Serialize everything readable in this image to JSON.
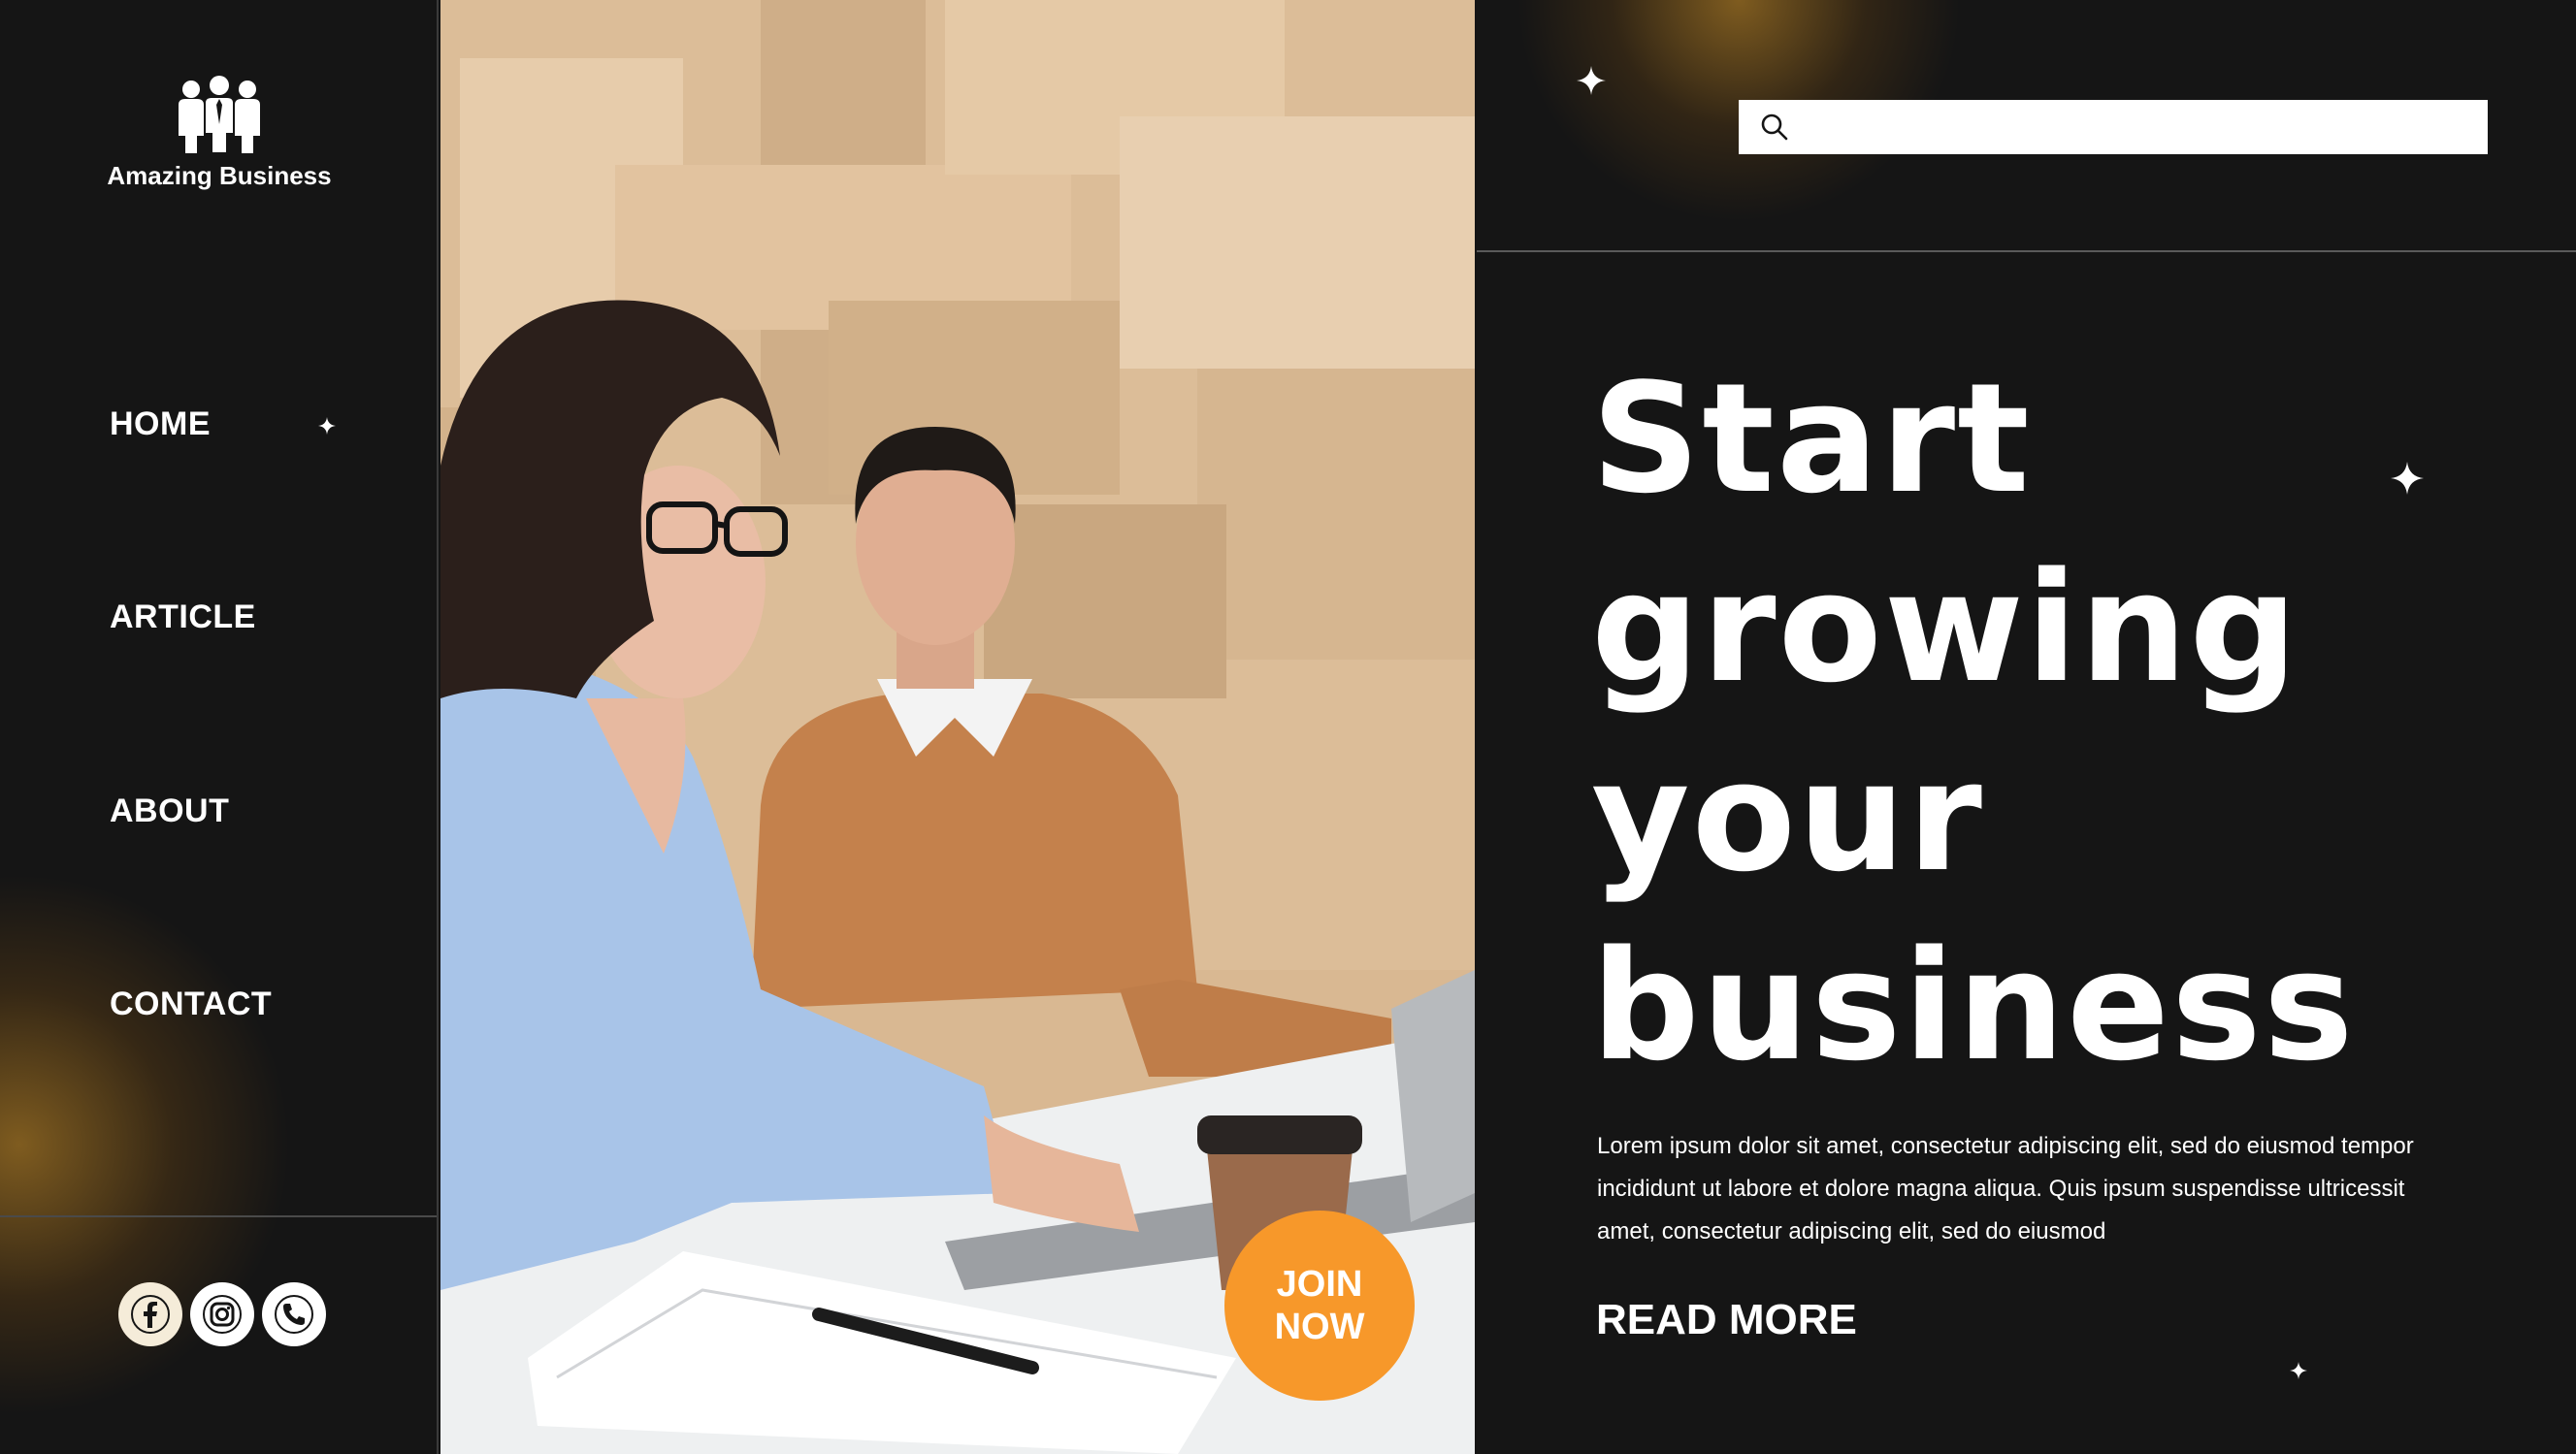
{
  "brand": {
    "name": "Amazing Business",
    "logo_icon": "business-people-icon"
  },
  "nav": {
    "items": [
      {
        "label": "HOME",
        "active": true
      },
      {
        "label": "ARTICLE"
      },
      {
        "label": "ABOUT"
      },
      {
        "label": "CONTACT"
      }
    ]
  },
  "socials": [
    {
      "name": "facebook-icon"
    },
    {
      "name": "instagram-icon"
    },
    {
      "name": "phone-icon"
    }
  ],
  "search": {
    "value": "",
    "placeholder": "",
    "icon": "search-icon"
  },
  "hero": {
    "headline": [
      "Start",
      "growing",
      "your",
      "business"
    ],
    "body": "Lorem ipsum dolor sit amet, consectetur adipiscing elit, sed do eiusmod tempor incididunt ut labore et dolore magna aliqua. Quis ipsum suspendisse ultricessit amet, consectetur adipiscing elit, sed do eiusmod",
    "cta_label": "READ MORE"
  },
  "join": {
    "line1": "JOIN",
    "line2": "NOW"
  },
  "colors": {
    "background": "#151515",
    "accent_orange": "#f7982a",
    "glow": "#d6962a",
    "text": "#ffffff"
  }
}
